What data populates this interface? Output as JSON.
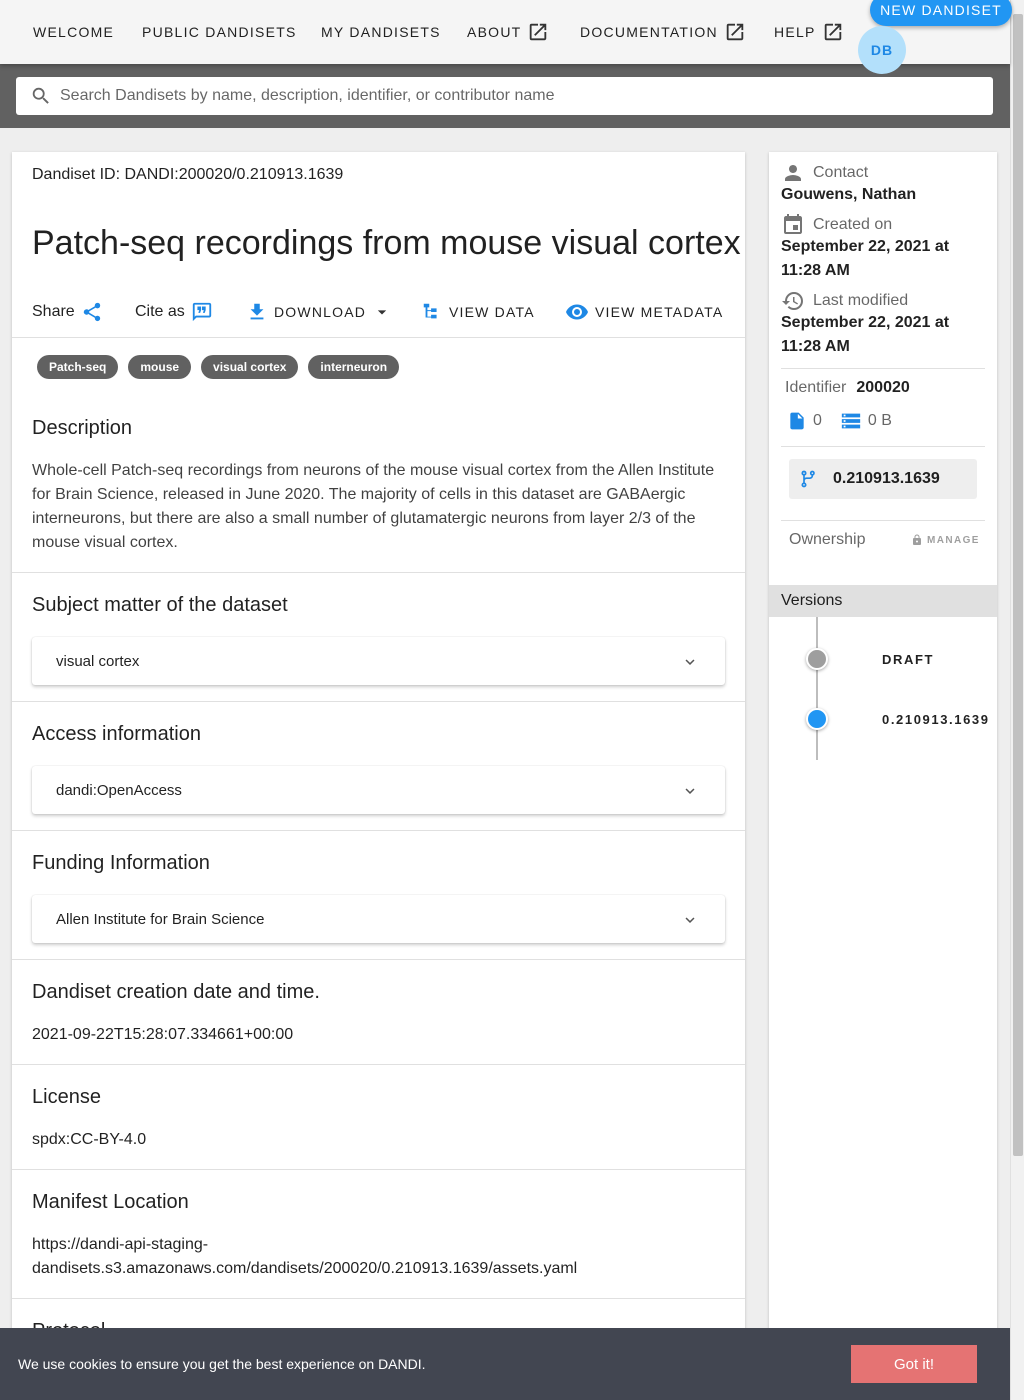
{
  "nav": {
    "items": [
      {
        "label": "WELCOME"
      },
      {
        "label": "PUBLIC DANDISETS"
      },
      {
        "label": "MY DANDISETS"
      },
      {
        "label": "ABOUT"
      },
      {
        "label": "DOCUMENTATION"
      },
      {
        "label": "HELP"
      }
    ],
    "new_dandiset": "NEW DANDISET",
    "avatar_initials": "DB"
  },
  "search": {
    "placeholder": "Search Dandisets by name, description, identifier, or contributor name",
    "value": ""
  },
  "dandiset": {
    "id_line": "Dandiset ID: DANDI:200020/0.210913.1639",
    "title": "Patch-seq recordings from mouse visual cortex",
    "actions": {
      "share": "Share",
      "cite": "Cite as",
      "download": "DOWNLOAD",
      "view_data": "VIEW DATA",
      "view_metadata": "VIEW METADATA"
    },
    "keywords": [
      "Patch-seq",
      "mouse",
      "visual cortex",
      "interneuron"
    ],
    "description_title": "Description",
    "description": "Whole-cell Patch-seq recordings from neurons of the mouse visual cortex from the Allen Institute for Brain Science, released in June 2020. The majority of cells in this dataset are GABAergic interneurons, but there are also a small number of glutamatergic neurons from layer 2/3 of the mouse visual cortex.",
    "subject_title": "Subject matter of the dataset",
    "subject_value": "visual cortex",
    "access_title": "Access information",
    "access_value": "dandi:OpenAccess",
    "funding_title": "Funding Information",
    "funding_value": "Allen Institute for Brain Science",
    "created_title": "Dandiset creation date and time.",
    "created_value": "2021-09-22T15:28:07.334661+00:00",
    "license_title": "License",
    "license_value": "spdx:CC-BY-4.0",
    "manifest_title": "Manifest Location",
    "manifest_line1": "https://dandi-api-staging-",
    "manifest_line2": "dandisets.s3.amazonaws.com/dandisets/200020/0.210913.1639/assets.yaml",
    "protocol_title": "Protocol"
  },
  "sidebar": {
    "contact_label": "Contact",
    "contact_value": "Gouwens, Nathan",
    "created_label": "Created on",
    "created_value_1": "September 22, 2021 at",
    "created_value_2": "11:28 AM",
    "modified_label": "Last modified",
    "modified_value_1": "September 22, 2021 at",
    "modified_value_2": "11:28 AM",
    "identifier_label": "Identifier",
    "identifier_value": "200020",
    "file_count": "0",
    "total_size": "0 B",
    "version": "0.210913.1639",
    "ownership_label": "Ownership",
    "manage_label": "MANAGE",
    "versions_label": "Versions",
    "versions": [
      {
        "label": "DRAFT",
        "color": "#9e9e9e"
      },
      {
        "label": "0.210913.1639",
        "color": "#2196f3"
      }
    ]
  },
  "cookie": {
    "text": "We use cookies to ensure you get the best experience on DANDI.",
    "button": "Got it!"
  },
  "colors": {
    "accent": "#2196f3",
    "chip_bg": "#616161",
    "cookie_bg": "#424651",
    "cookie_button": "#e57373"
  }
}
